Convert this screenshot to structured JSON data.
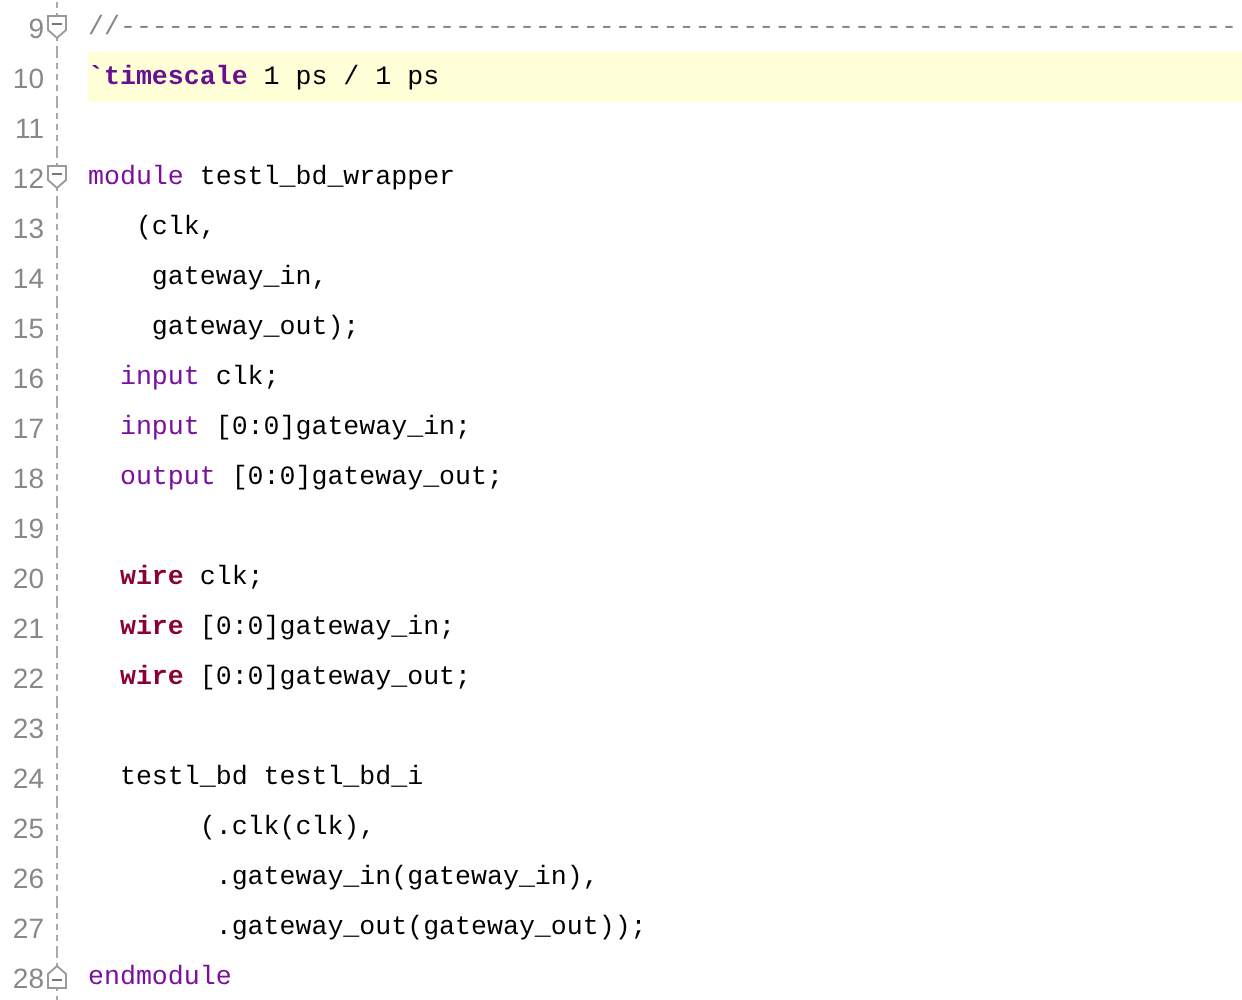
{
  "editor": {
    "lines": [
      {
        "number": "9",
        "fold_marker": {
          "kind": "start"
        },
        "current": false,
        "tokens": [
          {
            "kind": "comment",
            "text": "//----------------------------------------------------------------------"
          }
        ]
      },
      {
        "number": "10",
        "current": true,
        "tokens": [
          {
            "kind": "directive",
            "text": "`timescale"
          },
          {
            "kind": "plain",
            "text": " 1 ps / 1 ps"
          }
        ]
      },
      {
        "number": "11",
        "current": false
      },
      {
        "number": "12",
        "fold_marker": {
          "kind": "start"
        },
        "current": false,
        "tokens": [
          {
            "kind": "keyword",
            "text": "module"
          },
          {
            "kind": "plain",
            "text": " testl_bd_wrapper"
          }
        ]
      },
      {
        "number": "13",
        "current": false,
        "tokens": [
          {
            "kind": "plain",
            "text": "   (clk,"
          }
        ]
      },
      {
        "number": "14",
        "current": false,
        "tokens": [
          {
            "kind": "plain",
            "text": "    gateway_in,"
          }
        ]
      },
      {
        "number": "15",
        "current": false,
        "tokens": [
          {
            "kind": "plain",
            "text": "    gateway_out);"
          }
        ]
      },
      {
        "number": "16",
        "current": false,
        "tokens": [
          {
            "kind": "keyword",
            "text": "  input"
          },
          {
            "kind": "plain",
            "text": " clk;"
          }
        ]
      },
      {
        "number": "17",
        "current": false,
        "tokens": [
          {
            "kind": "keyword",
            "text": "  input"
          },
          {
            "kind": "plain",
            "text": " [0:0]gateway_in;"
          }
        ]
      },
      {
        "number": "18",
        "current": false,
        "tokens": [
          {
            "kind": "keyword",
            "text": "  output"
          },
          {
            "kind": "plain",
            "text": " [0:0]gateway_out;"
          }
        ]
      },
      {
        "number": "19",
        "current": false
      },
      {
        "number": "20",
        "current": false,
        "tokens": [
          {
            "kind": "type",
            "text": "  wire"
          },
          {
            "kind": "plain",
            "text": " clk;"
          }
        ]
      },
      {
        "number": "21",
        "current": false,
        "tokens": [
          {
            "kind": "type",
            "text": "  wire"
          },
          {
            "kind": "plain",
            "text": " [0:0]gateway_in;"
          }
        ]
      },
      {
        "number": "22",
        "current": false,
        "tokens": [
          {
            "kind": "type",
            "text": "  wire"
          },
          {
            "kind": "plain",
            "text": " [0:0]gateway_out;"
          }
        ]
      },
      {
        "number": "23",
        "current": false
      },
      {
        "number": "24",
        "current": false,
        "tokens": [
          {
            "kind": "plain",
            "text": "  testl_bd testl_bd_i"
          }
        ]
      },
      {
        "number": "25",
        "current": false,
        "tokens": [
          {
            "kind": "plain",
            "text": "       (.clk(clk),"
          }
        ]
      },
      {
        "number": "26",
        "current": false,
        "tokens": [
          {
            "kind": "plain",
            "text": "        .gateway_in(gateway_in),"
          }
        ]
      },
      {
        "number": "27",
        "current": false,
        "tokens": [
          {
            "kind": "plain",
            "text": "        .gateway_out(gateway_out));"
          }
        ]
      },
      {
        "number": "28",
        "fold_marker": {
          "kind": "end"
        },
        "current": false,
        "tokens": [
          {
            "kind": "keyword",
            "text": "endmodule"
          }
        ]
      }
    ]
  }
}
